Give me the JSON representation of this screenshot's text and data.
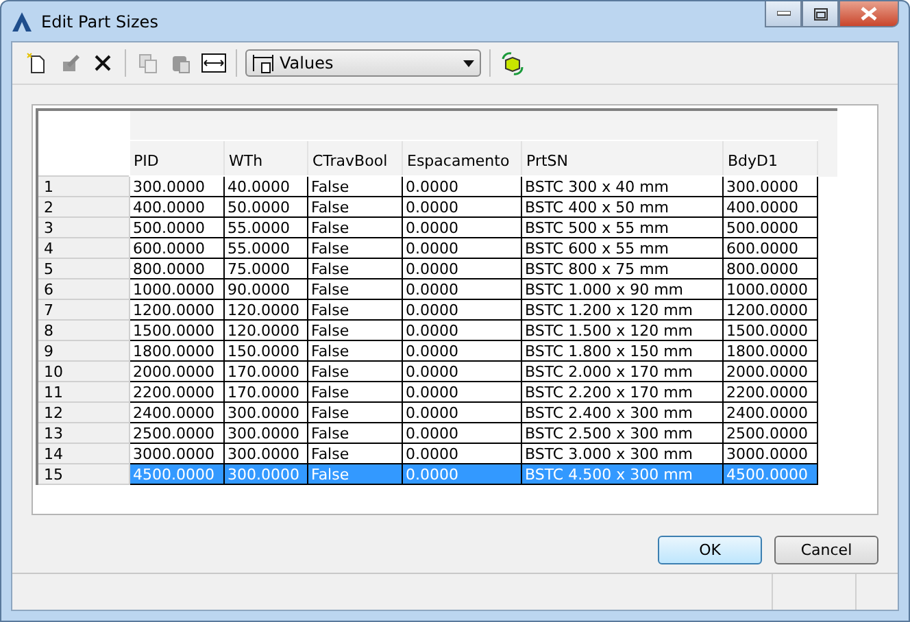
{
  "window": {
    "title": "Edit Part Sizes"
  },
  "toolbar": {
    "combo": {
      "value": "Values"
    }
  },
  "table": {
    "columns": [
      "PID",
      "WTh",
      "CTravBool",
      "Espacamento",
      "PrtSN",
      "BdyD1"
    ],
    "rows": [
      {
        "index": "1",
        "cells": [
          "300.0000",
          "40.0000",
          "False",
          "0.0000",
          "BSTC 300 x 40 mm",
          "300.0000"
        ],
        "selected": false
      },
      {
        "index": "2",
        "cells": [
          "400.0000",
          "50.0000",
          "False",
          "0.0000",
          "BSTC 400 x 50 mm",
          "400.0000"
        ],
        "selected": false
      },
      {
        "index": "3",
        "cells": [
          "500.0000",
          "55.0000",
          "False",
          "0.0000",
          "BSTC 500 x 55 mm",
          "500.0000"
        ],
        "selected": false
      },
      {
        "index": "4",
        "cells": [
          "600.0000",
          "55.0000",
          "False",
          "0.0000",
          "BSTC 600 x 55 mm",
          "600.0000"
        ],
        "selected": false
      },
      {
        "index": "5",
        "cells": [
          "800.0000",
          "75.0000",
          "False",
          "0.0000",
          "BSTC 800 x 75 mm",
          "800.0000"
        ],
        "selected": false
      },
      {
        "index": "6",
        "cells": [
          "1000.0000",
          "90.0000",
          "False",
          "0.0000",
          "BSTC 1.000 x 90 mm",
          "1000.0000"
        ],
        "selected": false
      },
      {
        "index": "7",
        "cells": [
          "1200.0000",
          "120.0000",
          "False",
          "0.0000",
          "BSTC 1.200 x 120 mm",
          "1200.0000"
        ],
        "selected": false
      },
      {
        "index": "8",
        "cells": [
          "1500.0000",
          "120.0000",
          "False",
          "0.0000",
          "BSTC 1.500 x 120 mm",
          "1500.0000"
        ],
        "selected": false
      },
      {
        "index": "9",
        "cells": [
          "1800.0000",
          "150.0000",
          "False",
          "0.0000",
          "BSTC 1.800 x 150 mm",
          "1800.0000"
        ],
        "selected": false
      },
      {
        "index": "10",
        "cells": [
          "2000.0000",
          "170.0000",
          "False",
          "0.0000",
          "BSTC 2.000 x 170 mm",
          "2000.0000"
        ],
        "selected": false
      },
      {
        "index": "11",
        "cells": [
          "2200.0000",
          "170.0000",
          "False",
          "0.0000",
          "BSTC 2.200 x 170 mm",
          "2200.0000"
        ],
        "selected": false
      },
      {
        "index": "12",
        "cells": [
          "2400.0000",
          "300.0000",
          "False",
          "0.0000",
          "BSTC 2.400 x 300 mm",
          "2400.0000"
        ],
        "selected": false
      },
      {
        "index": "13",
        "cells": [
          "2500.0000",
          "300.0000",
          "False",
          "0.0000",
          "BSTC 2.500 x 300 mm",
          "2500.0000"
        ],
        "selected": false
      },
      {
        "index": "14",
        "cells": [
          "3000.0000",
          "300.0000",
          "False",
          "0.0000",
          "BSTC 3.000 x 300 mm",
          "3000.0000"
        ],
        "selected": false
      },
      {
        "index": "15",
        "cells": [
          "4500.0000",
          "300.0000",
          "False",
          "0.0000",
          "BSTC 4.500 x 300 mm",
          "4500.0000"
        ],
        "selected": true
      }
    ]
  },
  "buttons": [
    "OK",
    "Cancel"
  ]
}
